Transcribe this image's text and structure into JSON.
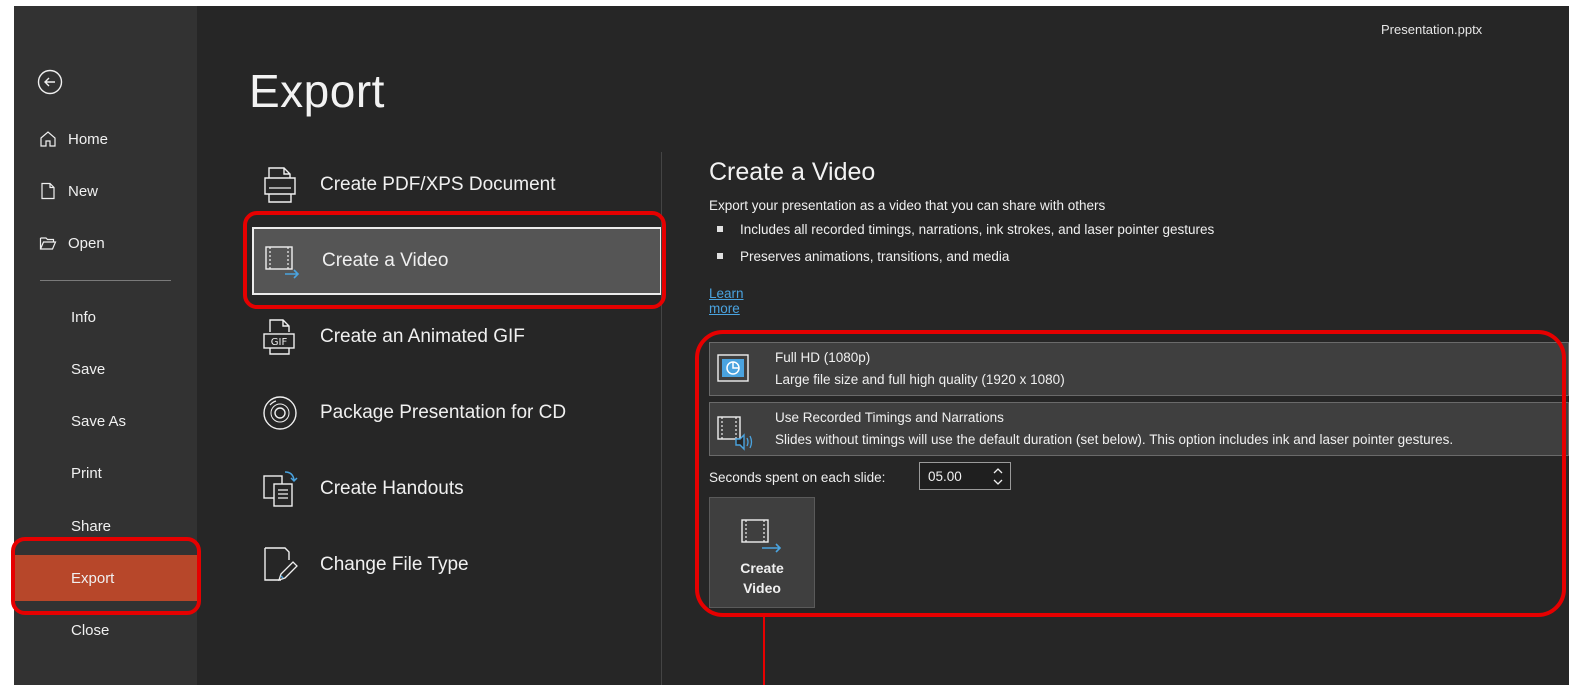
{
  "window": {
    "filename": "Presentation.pptx"
  },
  "sidebar": {
    "back_icon": "circle-left-arrow-icon",
    "items": [
      {
        "label": "Home",
        "icon": "home-icon"
      },
      {
        "label": "New",
        "icon": "new-document-icon"
      },
      {
        "label": "Open",
        "icon": "open-folder-icon"
      },
      {
        "label": "Info"
      },
      {
        "label": "Save"
      },
      {
        "label": "Save As"
      },
      {
        "label": "Print"
      },
      {
        "label": "Share"
      },
      {
        "label": "Export",
        "active": true
      },
      {
        "label": "Close"
      }
    ]
  },
  "page": {
    "title": "Export"
  },
  "options": [
    {
      "label": "Create PDF/XPS Document",
      "icon": "pdf-document-icon"
    },
    {
      "label": "Create a Video",
      "icon": "video-icon",
      "selected": true
    },
    {
      "label": "Create an Animated GIF",
      "icon": "gif-icon"
    },
    {
      "label": "Package Presentation for CD",
      "icon": "cd-icon"
    },
    {
      "label": "Create Handouts",
      "icon": "handouts-icon"
    },
    {
      "label": "Change File Type",
      "icon": "change-file-type-icon"
    }
  ],
  "detail": {
    "title": "Create a Video",
    "description": "Export your presentation as a video that you can share with others",
    "bullets": [
      "Includes all recorded timings, narrations, ink strokes, and laser pointer gestures",
      "Preserves animations, transitions, and media"
    ],
    "learn_more": "Learn more",
    "quality": {
      "title": "Full HD (1080p)",
      "subtitle": "Large file size and full high quality (1920 x 1080)",
      "icon": "monitor-icon"
    },
    "timings": {
      "title": "Use Recorded Timings and Narrations",
      "subtitle": "Slides without timings will use the default duration (set below). This option includes ink and laser pointer gestures.",
      "icon": "timings-narration-icon"
    },
    "seconds_label": "Seconds spent on each slide:",
    "seconds_value": "05.00",
    "create_button": {
      "line1": "Create",
      "line2": "Video",
      "icon": "create-video-icon"
    }
  },
  "colors": {
    "accent": "#b7472a",
    "annotation": "#e60000",
    "link": "#4aa3df",
    "background": "#262626",
    "sidebar": "#323232"
  }
}
